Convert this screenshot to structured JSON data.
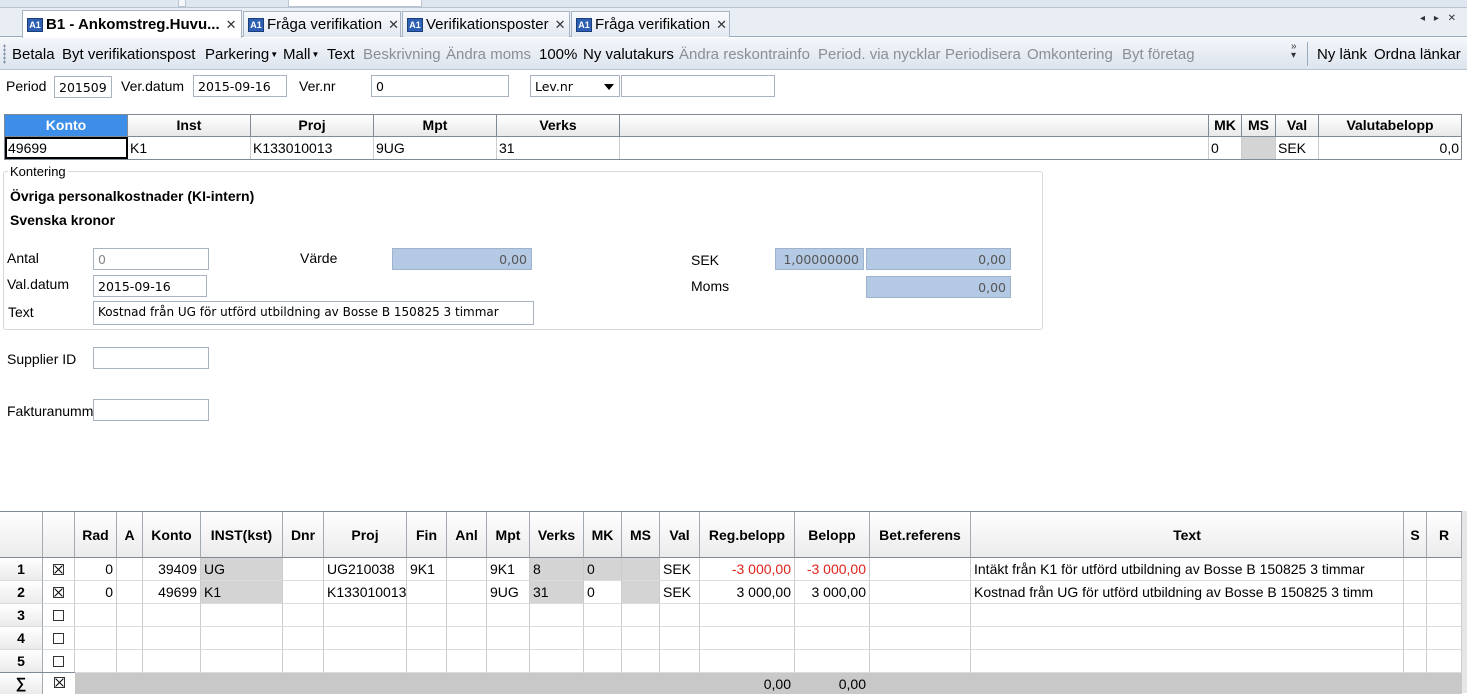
{
  "tabs": [
    {
      "label": "B1 - Ankomstreg.Huvu...",
      "active": true
    },
    {
      "label": "Fråga verifikation",
      "active": false
    },
    {
      "label": "Verifikationsposter",
      "active": false
    },
    {
      "label": "Fråga verifikation",
      "active": false
    }
  ],
  "tab_icon_text": "A1",
  "tab_close": "✕",
  "tab_nav": "◂ ▸ ✕",
  "toolbar": {
    "items": [
      {
        "label": "Betala",
        "enabled": true
      },
      {
        "label": "Byt verifikationspost",
        "enabled": true
      },
      {
        "label": "Parkering",
        "enabled": true,
        "dropdown": true
      },
      {
        "label": "Mall",
        "enabled": true,
        "dropdown": true
      },
      {
        "label": "Text",
        "enabled": true
      },
      {
        "label": "Beskrivning",
        "enabled": false
      },
      {
        "label": "Ändra moms",
        "enabled": false
      },
      {
        "label": "100%",
        "enabled": true
      },
      {
        "label": "Ny valutakurs",
        "enabled": true
      },
      {
        "label": "Ändra reskontrainfo",
        "enabled": false
      },
      {
        "label": "Period. via nycklar",
        "enabled": false
      },
      {
        "label": "Periodisera",
        "enabled": false
      },
      {
        "label": "Omkontering",
        "enabled": false
      },
      {
        "label": "Byt företag",
        "enabled": false
      }
    ],
    "right_items": [
      "Ny länk",
      "Ordna länkar"
    ],
    "overflow": "»"
  },
  "header": {
    "period_label": "Period",
    "period_value": "201509",
    "verdatum_label": "Ver.datum",
    "verdatum_value": "2015-09-16",
    "vernr_label": "Ver.nr",
    "vernr_value": "0",
    "levnr_select": "Lev.nr",
    "levnr_value": ""
  },
  "upper_grid": {
    "columns": [
      "Konto",
      "Inst",
      "Proj",
      "Mpt",
      "Verks",
      "",
      "MK",
      "MS",
      "Val",
      "Valutabelopp"
    ],
    "row": [
      "49699",
      "K1",
      "K133010013",
      "9UG",
      "31",
      "",
      "0",
      "",
      "SEK",
      "0,0"
    ]
  },
  "kontering": {
    "legend": "Kontering",
    "account_name": "Övriga personalkostnader (KI-intern)",
    "currency_name": "Svenska kronor",
    "antal_label": "Antal",
    "antal_value": "0",
    "varde_label": "Värde",
    "varde_value": "0,00",
    "sek_label": "SEK",
    "rate_value": "1,00000000",
    "sek_value": "0,00",
    "valdatum_label": "Val.datum",
    "valdatum_value": "2015-09-16",
    "moms_label": "Moms",
    "moms_value": "0,00",
    "text_label": "Text",
    "text_value": "Kostnad från UG  för utförd utbildning av Bosse B 150825 3 timmar"
  },
  "extra": {
    "supplier_label": "Supplier ID",
    "supplier_value": "",
    "faktura_label": "Fakturanumme",
    "faktura_value": ""
  },
  "rows_grid": {
    "columns": [
      "",
      "",
      "Rad",
      "A",
      "Konto",
      "INST(kst)",
      "Dnr",
      "Proj",
      "Fin",
      "Anl",
      "Mpt",
      "Verks",
      "MK",
      "MS",
      "Val",
      "Reg.belopp",
      "Belopp",
      "Bet.referens",
      "Text",
      "S",
      "R"
    ],
    "rows": [
      {
        "n": "1",
        "checked": true,
        "rad": "0",
        "a": "",
        "konto": "39409",
        "inst": "UG",
        "dnr": "",
        "proj": "UG210038",
        "fin": "9K1",
        "anl": "",
        "mpt": "9K1",
        "verks": "8",
        "mk": "0",
        "ms": "",
        "val": "SEK",
        "reg": "-3 000,00",
        "belopp": "-3 000,00",
        "bet": "",
        "text": "Intäkt från K1 för utförd utbildning av Bosse B 150825 3 timmar",
        "s": "",
        "r": "",
        "negative": true
      },
      {
        "n": "2",
        "checked": true,
        "rad": "0",
        "a": "",
        "konto": "49699",
        "inst": "K1",
        "dnr": "",
        "proj": "K133010013",
        "fin": "",
        "anl": "",
        "mpt": "9UG",
        "verks": "31",
        "mk": "0",
        "ms": "",
        "val": "SEK",
        "reg": "3 000,00",
        "belopp": "3 000,00",
        "bet": "",
        "text": "Kostnad från UG  för utförd utbildning av Bosse B 150825 3 timm",
        "s": "",
        "r": "",
        "negative": false
      },
      {
        "n": "3",
        "checked": false
      },
      {
        "n": "4",
        "checked": false
      },
      {
        "n": "5",
        "checked": false
      }
    ],
    "sum_symbol": "∑",
    "sum_reg": "0,00",
    "sum_belopp": "0,00"
  }
}
